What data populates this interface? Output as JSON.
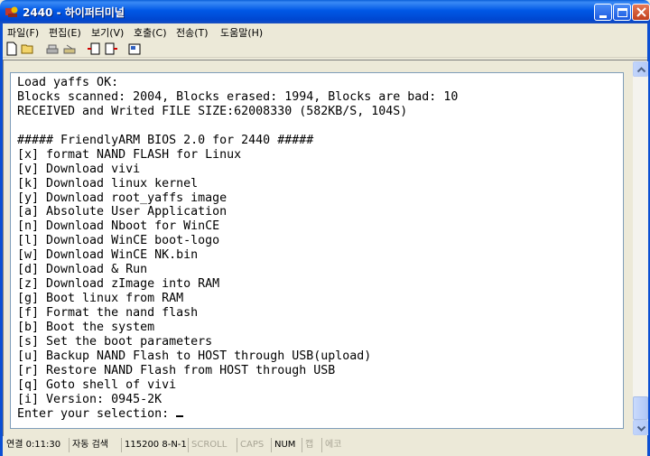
{
  "window": {
    "title": "2440 - 하이퍼터미널",
    "icon": "hyperterminal-icon"
  },
  "menu": {
    "items": [
      "파일(F)",
      "편집(E)",
      "보기(V)",
      "호출(C)",
      "전송(T)",
      "도움말(H)"
    ]
  },
  "toolbar": {
    "icons": [
      "new-icon",
      "open-icon",
      "call-icon",
      "disconnect-icon",
      "send-icon",
      "receive-icon",
      "properties-icon"
    ]
  },
  "terminal": {
    "lines": [
      "Load yaffs OK:",
      "Blocks scanned: 2004, Blocks erased: 1994, Blocks are bad: 10",
      "RECEIVED and Writed FILE SIZE:62008330 (582KB/S, 104S)",
      "",
      "##### FriendlyARM BIOS 2.0 for 2440 #####",
      "[x] format NAND FLASH for Linux",
      "[v] Download vivi",
      "[k] Download linux kernel",
      "[y] Download root_yaffs image",
      "[a] Absolute User Application",
      "[n] Download Nboot for WinCE",
      "[l] Download WinCE boot-logo",
      "[w] Download WinCE NK.bin",
      "[d] Download & Run",
      "[z] Download zImage into RAM",
      "[g] Boot linux from RAM",
      "[f] Format the nand flash",
      "[b] Boot the system",
      "[s] Set the boot parameters",
      "[u] Backup NAND Flash to HOST through USB(upload)",
      "[r] Restore NAND Flash from HOST through USB",
      "[q] Goto shell of vivi",
      "[i] Version: 0945-2K"
    ],
    "prompt": "Enter your selection: "
  },
  "statusbar": {
    "connected": "연결 0:11:30",
    "detect": "자동 검색",
    "settings": "115200 8-N-1",
    "scroll": "SCROLL",
    "caps": "CAPS",
    "num": "NUM",
    "capture": "캡",
    "echo": "에코"
  },
  "colors": {
    "title_bar": "#0058e6",
    "terminal_bg": "#ffffff",
    "chrome": "#ece9d8"
  }
}
